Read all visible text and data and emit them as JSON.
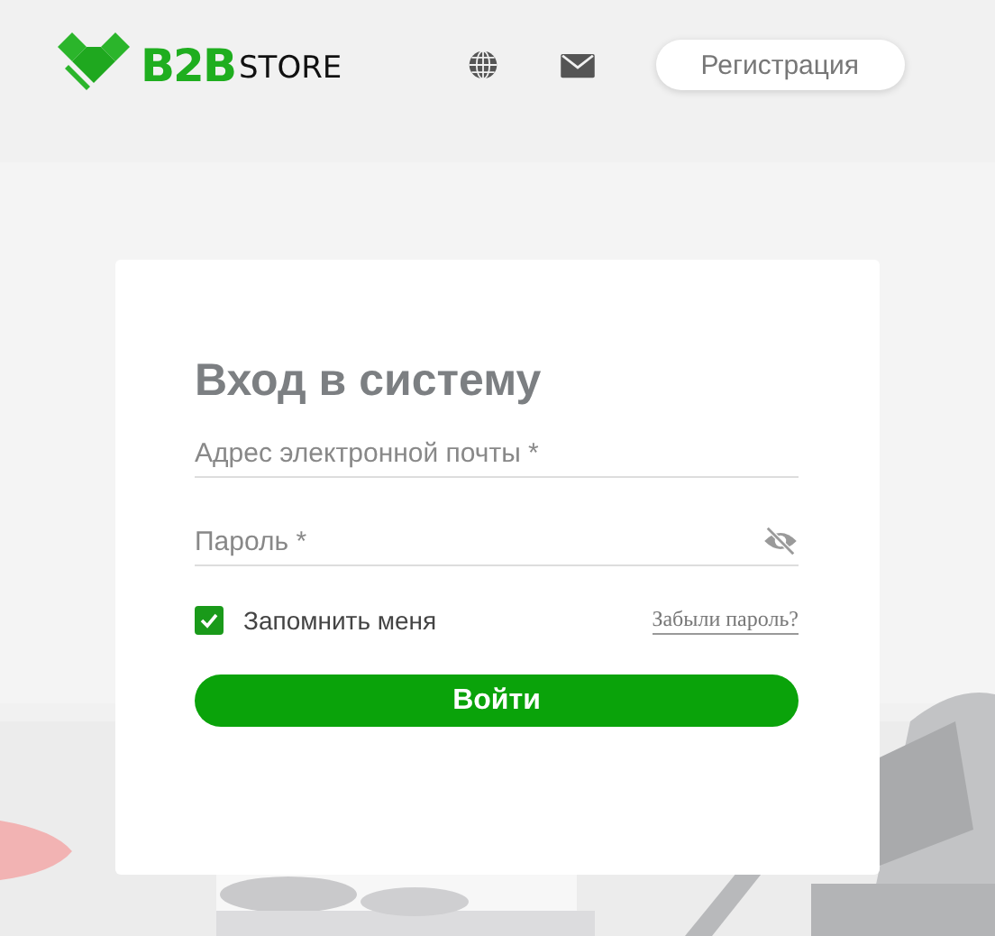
{
  "header": {
    "logo": {
      "brand": "B2B",
      "suffix": "STORE"
    },
    "register_button": "Регистрация"
  },
  "login": {
    "title": "Вход в систему",
    "fields": [
      {
        "kind": "email",
        "placeholder": "Адрес электронной почты *"
      },
      {
        "kind": "password",
        "placeholder": "Пароль *"
      }
    ],
    "remember": {
      "label": "Запомнить меня",
      "checked": true
    },
    "forgot_link": "Забыли пароль?",
    "submit": "Войти"
  }
}
